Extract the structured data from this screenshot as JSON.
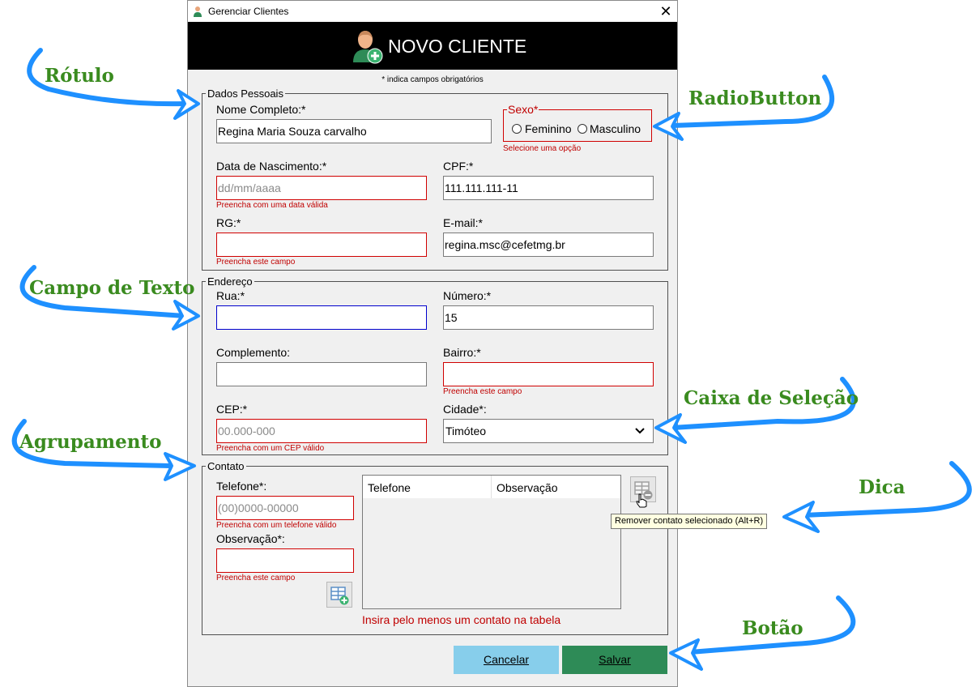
{
  "window": {
    "title": "Gerenciar Clientes",
    "close_glyph": "✕",
    "banner_title": "NOVO CLIENTE",
    "required_note": "* indica campos obrigatórios"
  },
  "dados_pessoais": {
    "legend": "Dados Pessoais",
    "nome_label": "Nome Completo:*",
    "nome_value": "Regina Maria Souza carvalho",
    "sexo_label": "Sexo*",
    "sexo_options": [
      "Feminino",
      "Masculino"
    ],
    "sexo_hint": "Selecione uma opção",
    "nascimento_label": "Data de Nascimento:*",
    "nascimento_placeholder": "dd/mm/aaaa",
    "nascimento_hint": "Preencha com uma data válida",
    "cpf_label": "CPF:*",
    "cpf_value": "111.111.111-11",
    "rg_label": "RG:*",
    "rg_value": "",
    "rg_hint": "Preencha este campo",
    "email_label": "E-mail:*",
    "email_value": "regina.msc@cefetmg.br"
  },
  "endereco": {
    "legend": "Endereço",
    "rua_label": "Rua:*",
    "rua_value": "",
    "numero_label": "Número:*",
    "numero_value": "15",
    "complemento_label": "Complemento:",
    "complemento_value": "",
    "bairro_label": "Bairro:*",
    "bairro_value": "",
    "bairro_hint": "Preencha este campo",
    "cep_label": "CEP:*",
    "cep_placeholder": "00.000-000",
    "cep_hint": "Preencha com um CEP válido",
    "cidade_label": "Cidade*:",
    "cidade_value": "Timóteo"
  },
  "contato": {
    "legend": "Contato",
    "telefone_label": "Telefone*:",
    "telefone_placeholder": "(00)0000-00000",
    "telefone_hint": "Preencha com um telefone válido",
    "observacao_label": "Observação*:",
    "observacao_value": "",
    "observacao_hint": "Preencha este campo",
    "table_columns": [
      "Telefone",
      "Observação"
    ],
    "table_hint": "Insira pelo menos um contato na tabela",
    "remove_tooltip": "Remover contato selecionado (Alt+R)",
    "add_icon": "table-add-icon",
    "remove_icon": "table-remove-icon"
  },
  "buttons": {
    "cancel": "Cancelar",
    "save": "Salvar"
  },
  "annotations": {
    "rotulo": "Rótulo",
    "radiobutton": "RadioButton",
    "campo_texto": "Campo de Texto",
    "caixa_selecao": "Caixa de Seleção",
    "agrupamento": "Agrupamento",
    "dica": "Dica",
    "botao": "Botão"
  },
  "colors": {
    "error": "#c00000",
    "annotation_text": "#3a8b1f",
    "annotation_arrow": "#1e90ff",
    "cancel_button": "#87ceeb",
    "save_button": "#2e8b57",
    "banner": "#000000"
  }
}
